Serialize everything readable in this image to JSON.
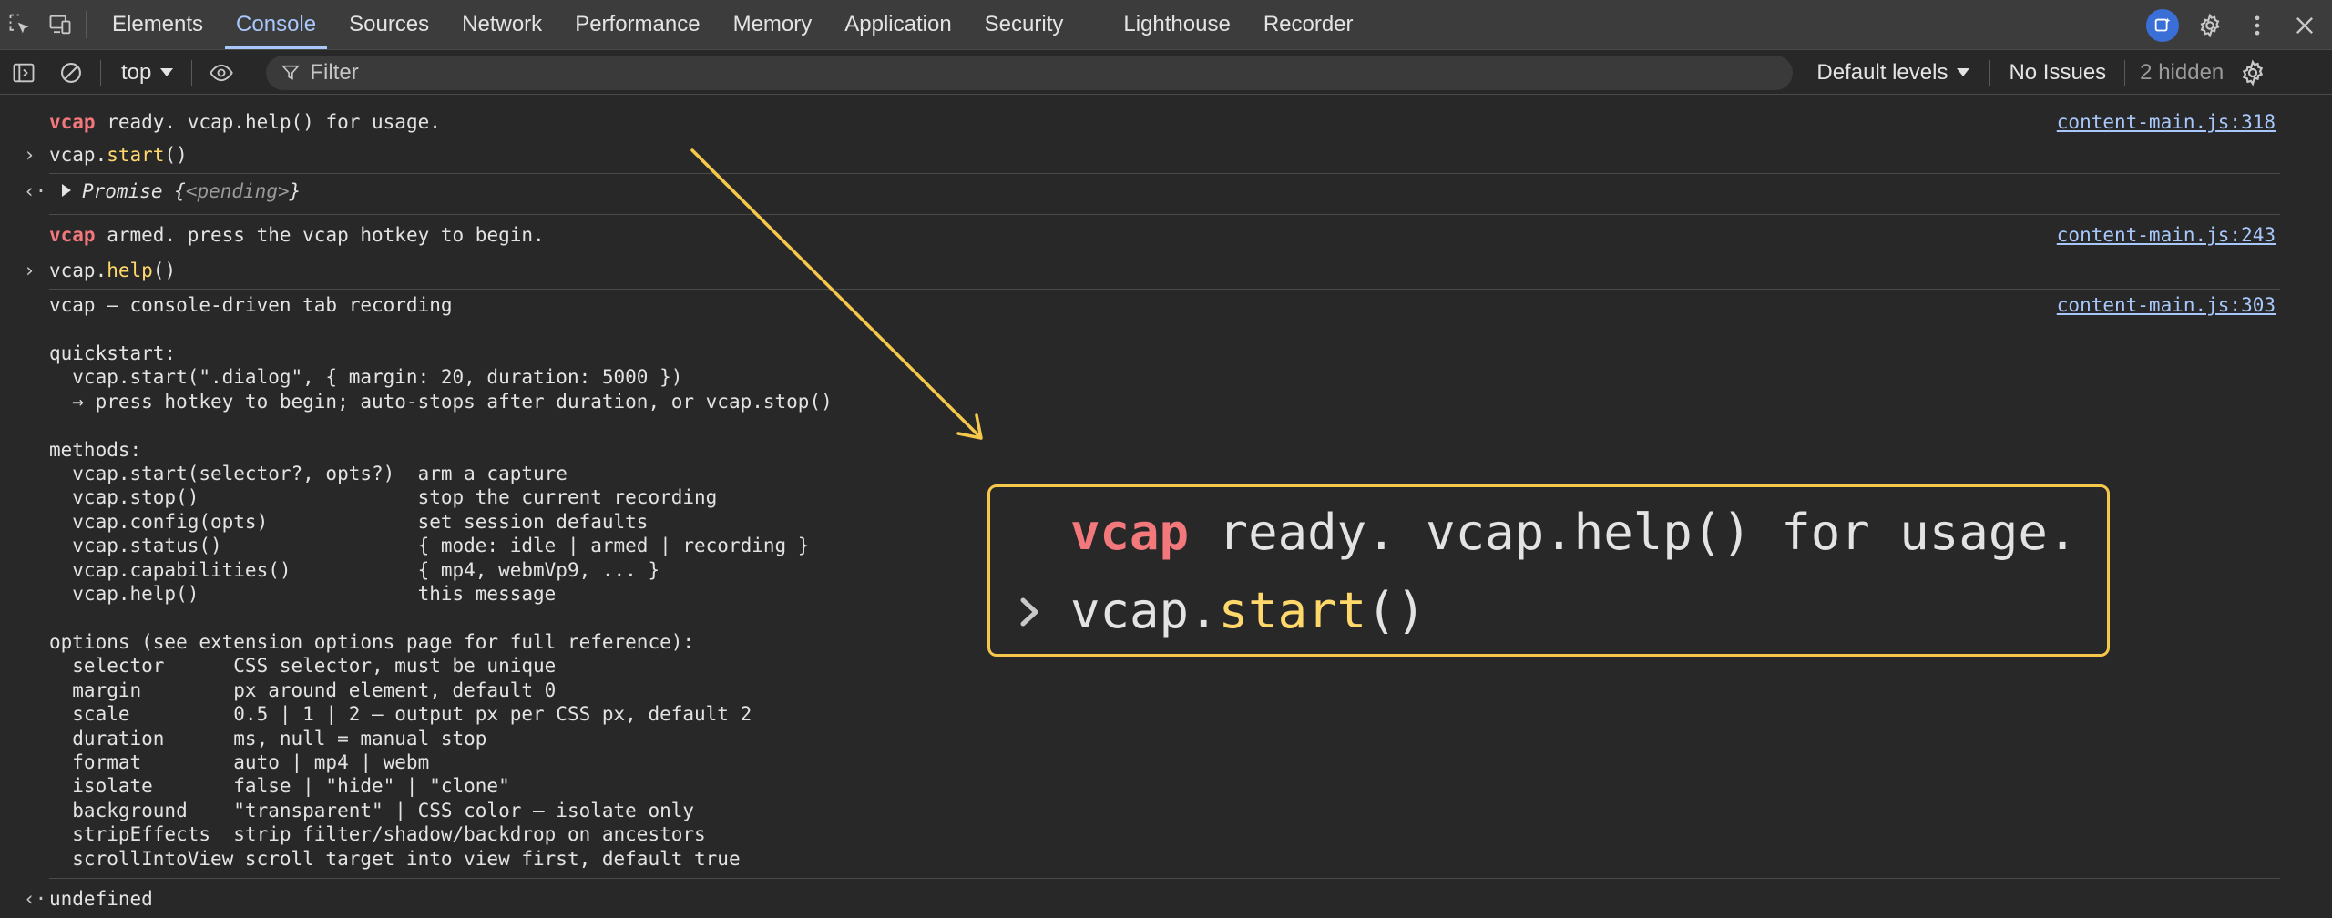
{
  "tabs": [
    "Elements",
    "Console",
    "Sources",
    "Network",
    "Performance",
    "Memory",
    "Application",
    "Security",
    "Lighthouse",
    "Recorder"
  ],
  "active_tab": "Console",
  "toolbar": {
    "context": "top",
    "filter_placeholder": "Filter",
    "levels": "Default levels",
    "issues": "No Issues",
    "hidden": "2 hidden"
  },
  "console": {
    "line1": {
      "prefix": "vcap",
      "rest": " ready. vcap.help() for usage.",
      "source": "content-main.js:318"
    },
    "line2": {
      "obj": "vcap.",
      "method": "start",
      "args": "()"
    },
    "line3": {
      "label": "Promise",
      "value_open": " {",
      "value": "<pending>",
      "value_close": "}"
    },
    "line4": {
      "prefix": "vcap",
      "rest": " armed. press the vcap hotkey to begin.",
      "source": "content-main.js:243"
    },
    "line5": {
      "obj": "vcap.",
      "method": "help",
      "args": "()"
    },
    "line6": {
      "text": "vcap — console-driven tab recording",
      "source": "content-main.js:303"
    },
    "help_text": "quickstart:\n  vcap.start(\".dialog\", { margin: 20, duration: 5000 })\n  → press hotkey to begin; auto-stops after duration, or vcap.stop()\n\nmethods:\n  vcap.start(selector?, opts?)  arm a capture\n  vcap.stop()                   stop the current recording\n  vcap.config(opts)             set session defaults\n  vcap.status()                 { mode: idle | armed | recording }\n  vcap.capabilities()           { mp4, webmVp9, ... }\n  vcap.help()                   this message\n\noptions (see extension options page for full reference):\n  selector      CSS selector, must be unique\n  margin        px around element, default 0\n  scale         0.5 | 1 | 2 — output px per CSS px, default 2\n  duration      ms, null = manual stop\n  format        auto | mp4 | webm\n  isolate       false | \"hide\" | \"clone\"\n  background    \"transparent\" | CSS color — isolate only\n  stripEffects  strip filter/shadow/backdrop on ancestors\n  scrollIntoView scroll target into view first, default true",
    "result": "undefined"
  },
  "callout": {
    "prefix": "vcap",
    "rest": " ready. vcap.help() for usage.",
    "obj": "vcap.",
    "method": "start",
    "args": "()"
  },
  "colors": {
    "accent": "#a8c7fa",
    "highlight": "#f5c84c",
    "vcap_red": "#f2787b",
    "method_yellow": "#ffd86b",
    "background": "#282828"
  }
}
